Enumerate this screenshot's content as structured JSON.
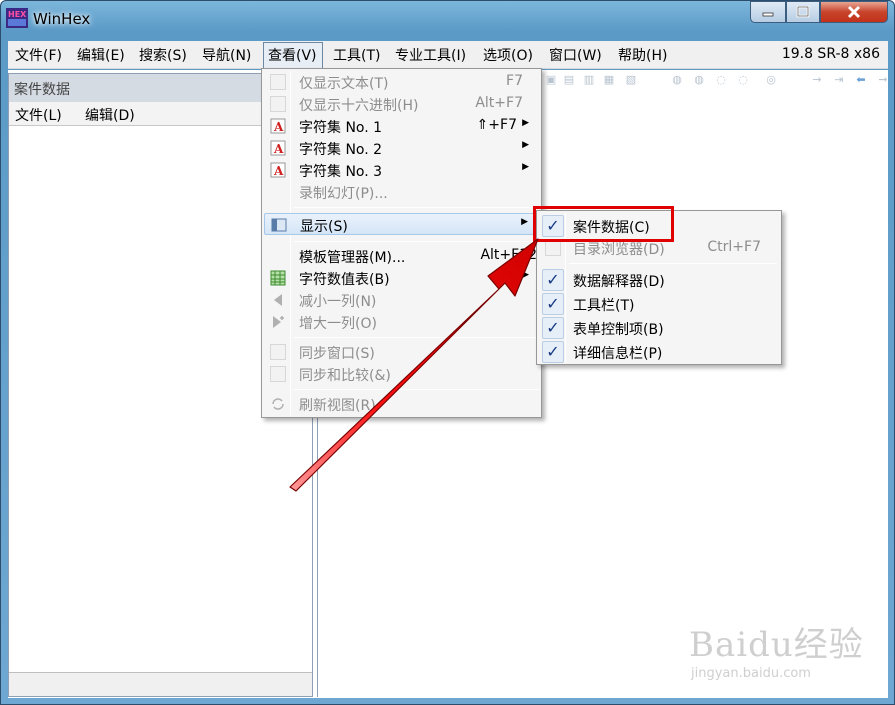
{
  "window": {
    "title": "WinHex"
  },
  "menubar": {
    "items": [
      "文件(F)",
      "编辑(E)",
      "搜索(S)",
      "导航(N)",
      "查看(V)",
      "工具(T)",
      "专业工具(I)",
      "选项(O)",
      "窗口(W)",
      "帮助(H)"
    ],
    "version": "19.8 SR-8 x86"
  },
  "case_panel": {
    "title": "案件数据",
    "menu": [
      "文件(L)",
      "编辑(D)"
    ]
  },
  "view_menu": {
    "items": [
      {
        "label": "仅显示文本(T)",
        "shortcut": "F7",
        "enabled": false
      },
      {
        "label": "仅显示十六进制(H)",
        "shortcut": "Alt+F7",
        "enabled": false
      },
      {
        "label": "字符集 No. 1",
        "shortcut": "⇑+F7",
        "enabled": true
      },
      {
        "label": "字符集 No. 2",
        "shortcut": "",
        "enabled": true
      },
      {
        "label": "字符集 No. 3",
        "shortcut": "",
        "enabled": true
      },
      {
        "label": "录制幻灯(P)...",
        "shortcut": "",
        "enabled": false
      },
      {
        "label": "显示(S)",
        "shortcut": "",
        "enabled": true
      },
      {
        "label": "模板管理器(M)...",
        "shortcut": "Alt+F12",
        "enabled": true
      },
      {
        "label": "字符数值表(B)",
        "shortcut": "",
        "enabled": true
      },
      {
        "label": "减小一列(N)",
        "shortcut": "",
        "enabled": false
      },
      {
        "label": "增大一列(O)",
        "shortcut": "",
        "enabled": false
      },
      {
        "label": "同步窗口(S)",
        "shortcut": "",
        "enabled": false
      },
      {
        "label": "同步和比较(&)",
        "shortcut": "",
        "enabled": false
      },
      {
        "label": "刷新视图(R)",
        "shortcut": "",
        "enabled": false
      }
    ]
  },
  "display_submenu": {
    "items": [
      {
        "label": "案件数据(C)",
        "shortcut": "",
        "checked": true,
        "enabled": true
      },
      {
        "label": "目录浏览器(D)",
        "shortcut": "Ctrl+F7",
        "checked": false,
        "enabled": false
      },
      {
        "label": "数据解释器(D)",
        "shortcut": "",
        "checked": true,
        "enabled": true
      },
      {
        "label": "工具栏(T)",
        "shortcut": "",
        "checked": true,
        "enabled": true
      },
      {
        "label": "表单控制项(B)",
        "shortcut": "",
        "checked": true,
        "enabled": true
      },
      {
        "label": "详细信息栏(P)",
        "shortcut": "",
        "checked": true,
        "enabled": true
      }
    ]
  },
  "watermark": {
    "main": "Baidu经验",
    "sub": "jingyan.baidu.com"
  },
  "colors": {
    "highlight_box": "#e00000",
    "arrow": "#e00000",
    "title_bar": "#6ea8d2",
    "check": "#173a86"
  },
  "icons": {
    "app": "winhex-hex-icon",
    "charset": "letter-a-icon",
    "display": "panel-icon",
    "table": "grid-table-icon",
    "shrink": "triangle-left-icon",
    "grow": "triangle-right-plus-icon",
    "refresh": "refresh-icon",
    "check": "checkmark-icon"
  }
}
